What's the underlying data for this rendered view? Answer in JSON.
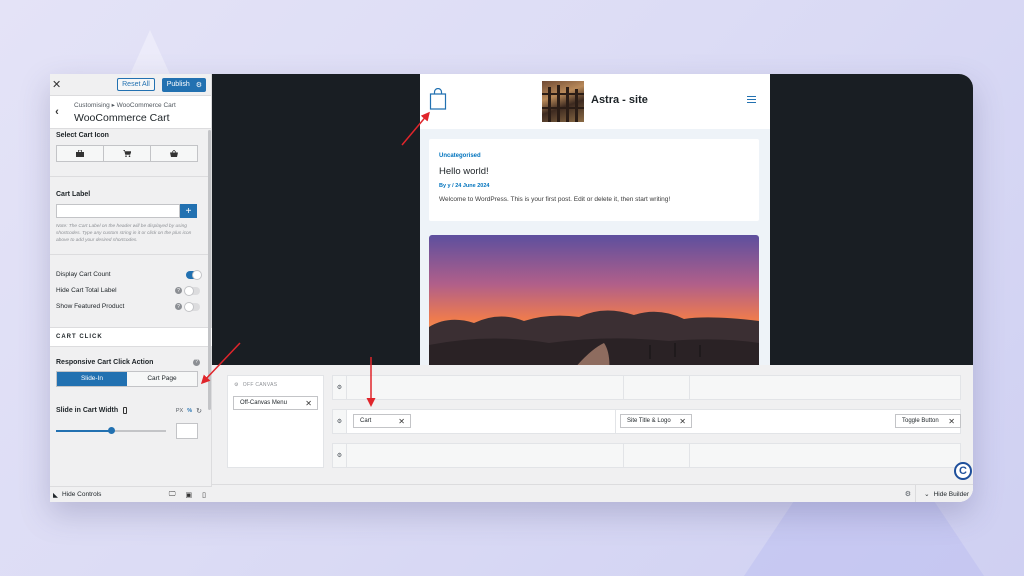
{
  "sidebar": {
    "reset_label": "Reset All",
    "publish_label": "Publish",
    "breadcrumb": "Customising ▸ WooCommerce Cart",
    "title": "WooCommerce Cart",
    "select_cart_icon_label": "Select Cart Icon",
    "cart_icons": [
      "bag-icon",
      "cart-icon",
      "basket-icon"
    ],
    "cart_label_heading": "Cart Label",
    "cart_label_value": "",
    "note": "Note: The Cart Label on the header will be displayed by using shortcodes. Type any custom string in it or click on the plus icon above to add your desired shortcodes.",
    "toggles": [
      {
        "label": "Display Cart Count",
        "on": true,
        "help": false
      },
      {
        "label": "Hide Cart Total Label",
        "on": false,
        "help": true
      },
      {
        "label": "Show Featured Product",
        "on": false,
        "help": true
      }
    ],
    "cart_click_heading": "CART CLICK",
    "responsive_action_label": "Responsive Cart Click Action",
    "action_options": [
      "Slide-In",
      "Cart Page"
    ],
    "action_selected": "Slide-In",
    "slide_width_label": "Slide in Cart Width",
    "units": [
      "PX",
      "%"
    ],
    "unit_selected": "%",
    "slide_width_fraction": 0.5,
    "slide_width_value": "",
    "hide_controls_label": "Hide Controls"
  },
  "preview": {
    "site_title": "Astra - site",
    "post": {
      "category": "Uncategorised",
      "title": "Hello world!",
      "meta": "By y / 24 June 2024",
      "excerpt": "Welcome to WordPress. This is your first post. Edit or delete it, then start writing!"
    }
  },
  "builder": {
    "off_canvas_label": "OFF CANVAS",
    "off_canvas_chip": "Off-Canvas Menu",
    "cart_chip": "Cart",
    "site_title_chip": "Site Title & Logo",
    "toggle_chip": "Toggle Button",
    "hide_builder_label": "Hide Builder"
  },
  "colors": {
    "accent": "#2271b1",
    "arrow": "#e0252b",
    "preview_bg": "#191e23"
  }
}
